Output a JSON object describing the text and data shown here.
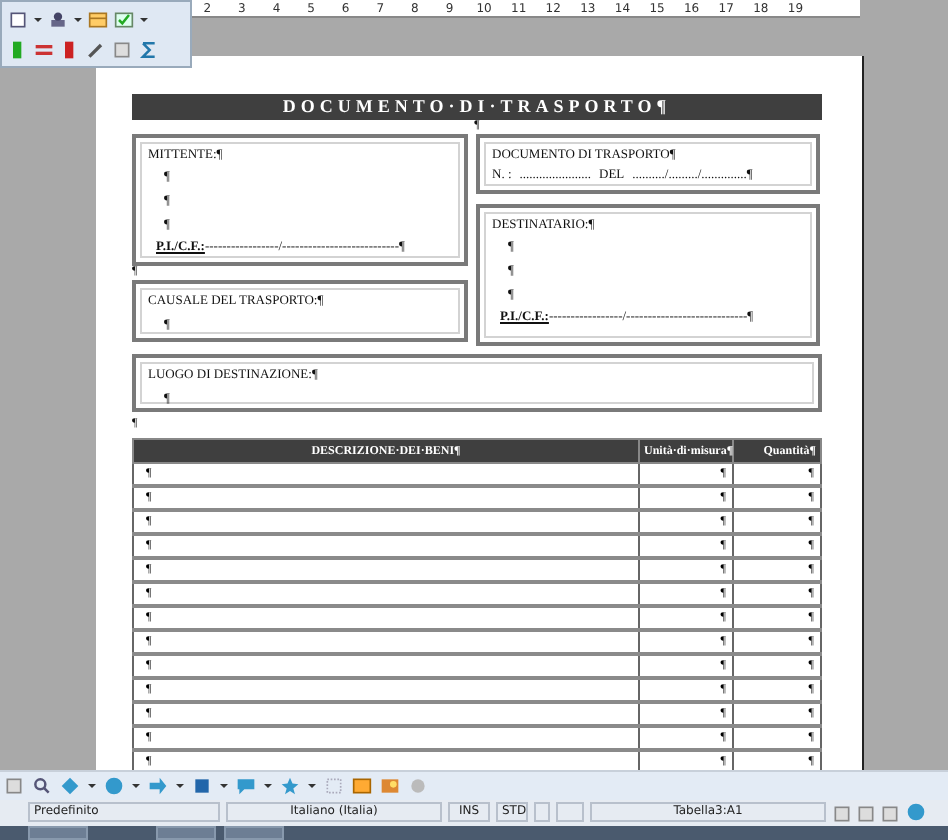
{
  "ruler": {
    "marks": [
      "2",
      "3",
      "4",
      "5",
      "6",
      "7",
      "8",
      "9",
      "10",
      "11",
      "12",
      "13",
      "14",
      "15",
      "16",
      "17",
      "18",
      "19"
    ]
  },
  "document": {
    "title": "DOCUMENTO·DI·TRASPORTO¶",
    "after_title": "¶",
    "sender": {
      "label": "MITTENTE:¶",
      "lines": [
        "¶",
        "¶",
        "¶"
      ],
      "tax_label": "P.I./C.F.:",
      "tax_line": "-----------------/---------------------------¶"
    },
    "between_left": "¶",
    "transport_doc": {
      "label": "DOCUMENTO DI TRASPORTO¶",
      "number_label": "N. :",
      "number_line": "......................",
      "date_label": "DEL",
      "date_line": "........../........./..............¶"
    },
    "recipient": {
      "label": "DESTINATARIO:¶",
      "lines": [
        "¶",
        "¶",
        "¶"
      ],
      "tax_label": "P.I./C.F.:",
      "tax_line": "-----------------/----------------------------¶"
    },
    "reason": {
      "label": "CAUSALE DEL TRASPORTO:¶",
      "lines": [
        "¶"
      ]
    },
    "destination": {
      "label": "LUOGO DI DESTINAZIONE:¶",
      "lines": [
        "¶"
      ]
    },
    "after_boxes": "¶",
    "table": {
      "columns": [
        "DESCRIZIONE·DEI·BENI¶",
        "Unità·di·misura¶",
        "Quantità¶"
      ],
      "rows": [
        [
          "¶",
          "¶",
          "¶"
        ],
        [
          "¶",
          "¶",
          "¶"
        ],
        [
          "¶",
          "¶",
          "¶"
        ],
        [
          "¶",
          "¶",
          "¶"
        ],
        [
          "¶",
          "¶",
          "¶"
        ],
        [
          "¶",
          "¶",
          "¶"
        ],
        [
          "¶",
          "¶",
          "¶"
        ],
        [
          "¶",
          "¶",
          "¶"
        ],
        [
          "¶",
          "¶",
          "¶"
        ],
        [
          "¶",
          "¶",
          "¶"
        ],
        [
          "¶",
          "¶",
          "¶"
        ],
        [
          "¶",
          "¶",
          "¶"
        ],
        [
          "¶",
          "¶",
          "¶"
        ]
      ]
    }
  },
  "status_bar": {
    "page_style": "Predefinito",
    "language": "Italiano (Italia)",
    "insert_mode": "INS",
    "selection_mode": "STD",
    "cell": "Tabella3:A1"
  }
}
